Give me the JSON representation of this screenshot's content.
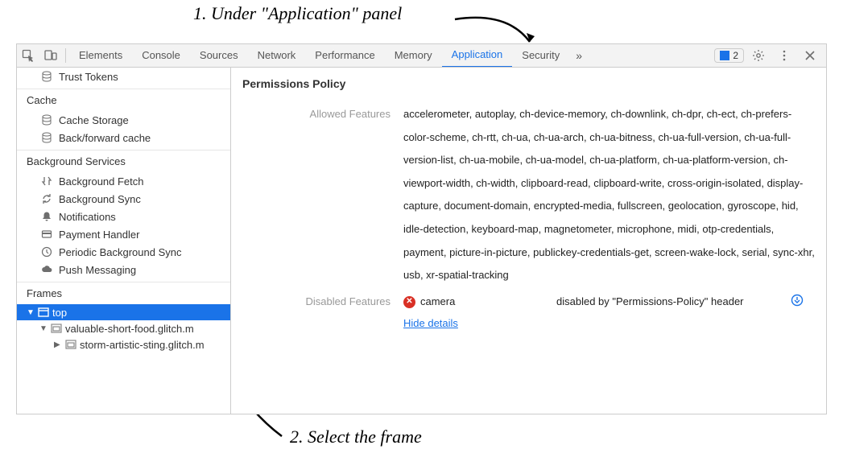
{
  "annotations": {
    "a1": "1. Under \"Application\" panel",
    "a2": "2. Select the frame"
  },
  "toolbar": {
    "tabs": {
      "elements": "Elements",
      "console": "Console",
      "sources": "Sources",
      "network": "Network",
      "performance": "Performance",
      "memory": "Memory",
      "application": "Application",
      "security": "Security"
    },
    "more_chevron": "»",
    "issue_count": "2"
  },
  "sidebar": {
    "trust_tokens": "Trust Tokens",
    "cache_header": "Cache",
    "cache_storage": "Cache Storage",
    "bf_cache": "Back/forward cache",
    "bg_header": "Background Services",
    "bg_fetch": "Background Fetch",
    "bg_sync": "Background Sync",
    "notifications": "Notifications",
    "payment_handler": "Payment Handler",
    "periodic_sync": "Periodic Background Sync",
    "push_msg": "Push Messaging",
    "frames_header": "Frames",
    "tree": {
      "top": "top",
      "child1": "valuable-short-food.glitch.m",
      "child2": "storm-artistic-sting.glitch.m"
    }
  },
  "content": {
    "section_title": "Permissions Policy",
    "allowed_label": "Allowed Features",
    "allowed_value": "accelerometer, autoplay, ch-device-memory, ch-downlink, ch-dpr, ch-ect, ch-prefers-color-scheme, ch-rtt, ch-ua, ch-ua-arch, ch-ua-bitness, ch-ua-full-version, ch-ua-full-version-list, ch-ua-mobile, ch-ua-model, ch-ua-platform, ch-ua-platform-version, ch-viewport-width, ch-width, clipboard-read, clipboard-write, cross-origin-isolated, display-capture, document-domain, encrypted-media, fullscreen, geolocation, gyroscope, hid, idle-detection, keyboard-map, magnetometer, microphone, midi, otp-credentials, payment, picture-in-picture, publickey-credentials-get, screen-wake-lock, serial, sync-xhr, usb, xr-spatial-tracking",
    "disabled_label": "Disabled Features",
    "disabled_feature": "camera",
    "disabled_reason": "disabled by \"Permissions-Policy\" header",
    "hide_details": "Hide details"
  }
}
